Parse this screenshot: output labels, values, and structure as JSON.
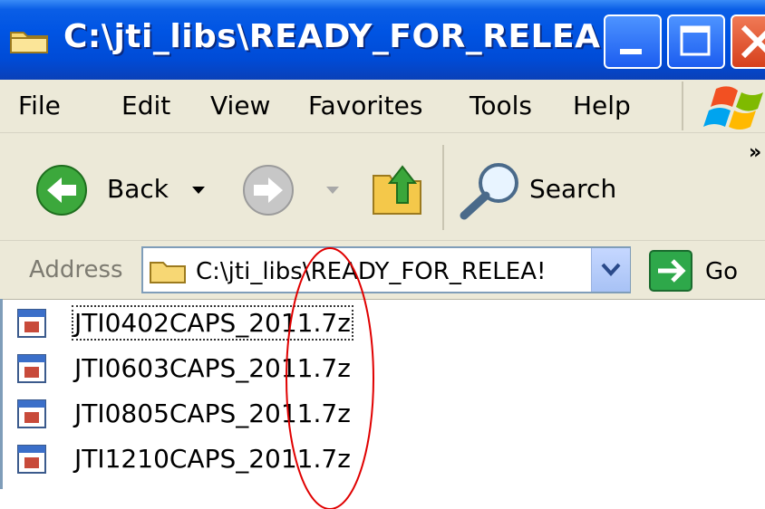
{
  "window": {
    "title": "C:\\jti_libs\\READY_FOR_RELEA...",
    "buttons": [
      "minimize",
      "maximize",
      "close"
    ]
  },
  "menu": {
    "items": [
      "File",
      "Edit",
      "View",
      "Favorites",
      "Tools",
      "Help"
    ]
  },
  "toolbar": {
    "back_label": "Back",
    "search_label": "Search",
    "chevron": "»"
  },
  "address": {
    "label": "Address",
    "value": "C:\\jti_libs\\READY_FOR_RELEA!",
    "go_label": "Go"
  },
  "files": [
    "JTI0402CAPS_2011.7z",
    "JTI0603CAPS_2011.7z",
    "JTI0805CAPS_2011.7z",
    "JTI1210CAPS_2011.7z"
  ],
  "colors": {
    "titlebar": "#0054e3",
    "chrome": "#ece9d8",
    "annotation": "#e00000"
  }
}
